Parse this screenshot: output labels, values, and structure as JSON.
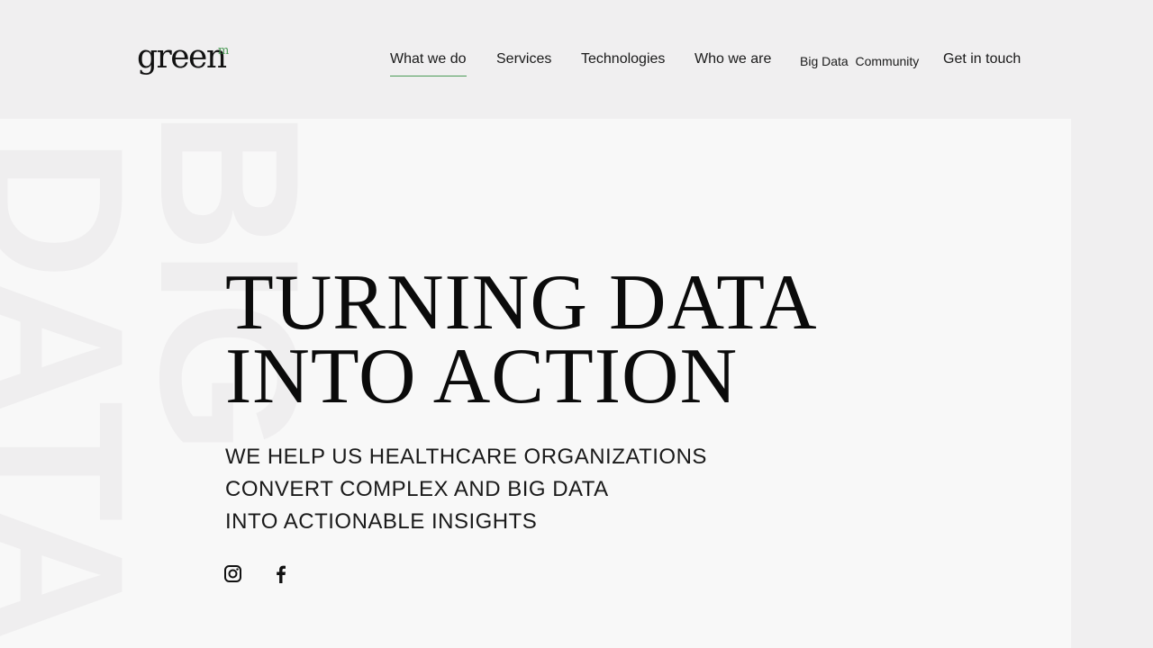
{
  "logo": {
    "text": "green",
    "superscript": "m"
  },
  "nav": {
    "what_we_do": "What we do",
    "services": "Services",
    "technologies": "Technologies",
    "who_we_are": "Who we are",
    "big_data_community": "Big Data  Community",
    "get_in_touch": "Get in touch"
  },
  "hero": {
    "background_words": [
      "BIG",
      "DATA"
    ],
    "headline_line1": "TURNING DATA",
    "headline_line2": "INTO ACTION",
    "sub_line1": "WE HELP US HEALTHCARE ORGANIZATIONS",
    "sub_line2": "CONVERT COMPLEX AND BIG DATA",
    "sub_line3": "INTO ACTIONABLE INSIGHTS"
  },
  "social": {
    "icons": [
      "instagram-icon",
      "facebook-icon"
    ]
  },
  "colors": {
    "accent": "#4a9a55",
    "background": "#f0eff0",
    "hero_panel": "#f8f8f8"
  }
}
